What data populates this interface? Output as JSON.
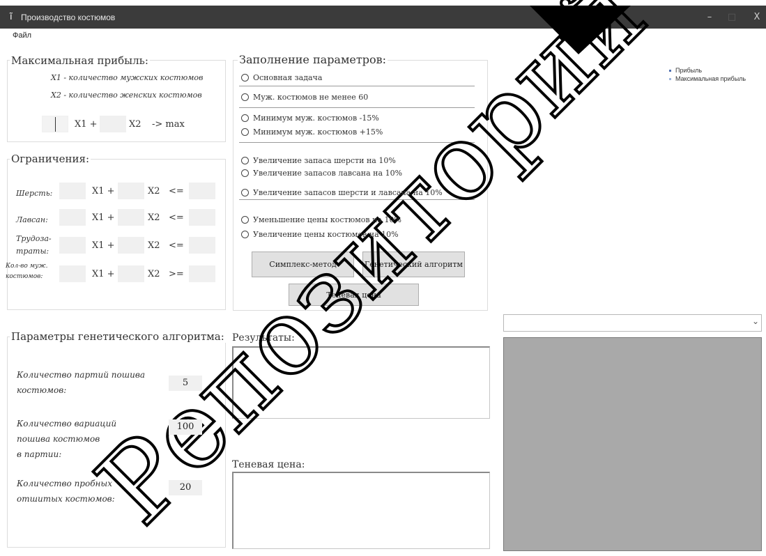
{
  "window": {
    "title": "Производство костюмов",
    "minimize_glyph": "–",
    "maximize_glyph": "□",
    "close_glyph": "X"
  },
  "menu": {
    "file": "Файл"
  },
  "max_profit": {
    "title": "Максимальная прибыль:",
    "x1_desc": "X1 - количество мужских костюмов",
    "x2_desc": "X2 - количество женских костюмов",
    "x1_label": "X1 +",
    "x2_label": "X2",
    "goal": "-> max",
    "x1_value": "",
    "x2_value": ""
  },
  "constraints": {
    "title": "Ограничения:",
    "rows": [
      {
        "label_lines": [
          "Шерсть:"
        ],
        "x1": "X1 +",
        "x2": "X2",
        "op": "<="
      },
      {
        "label_lines": [
          "Лавсан:"
        ],
        "x1": "X1 +",
        "x2": "X2",
        "op": "<="
      },
      {
        "label_lines": [
          "Трудоза-",
          "траты:"
        ],
        "x1": "X1 +",
        "x2": "X2",
        "op": "<="
      },
      {
        "label_lines": [
          "Кол-во муж.",
          "костюмов:"
        ],
        "x1": "X1 +",
        "x2": "X2",
        "op": ">="
      }
    ]
  },
  "params": {
    "title": "Заполнение параметров:",
    "options": [
      "Основная задача",
      "Муж. костюмов не менее 60",
      "Минимум муж. костюмов -15%",
      "Минимум муж. костюмов +15%",
      "Увеличение запаса шерсти на 10%",
      "Увеличение запасов лавсана на 10%",
      "Увеличение запасов шерсти и лавсана на 10%",
      "Уменьшение цены костюмов на 10%",
      "Увеличение цены костюмов на 10%"
    ],
    "buttons": {
      "simplex": "Симплекс-метод",
      "genetic": "Генетический алгоритм",
      "shadow": "Теневая цена"
    }
  },
  "genetic": {
    "title": "Параметры генетического алгоритма:",
    "fields": [
      {
        "label_lines": [
          "Количество партий пошива",
          "костюмов:"
        ],
        "value": "5"
      },
      {
        "label_lines": [
          "Количество вариаций",
          "пошива костюмов",
          "в партии:"
        ],
        "value": "100"
      },
      {
        "label_lines": [
          "Количество пробных",
          "отшитых костюмов:"
        ],
        "value": "20"
      }
    ]
  },
  "results": {
    "title": "Результаты:",
    "value": ""
  },
  "shadow_price": {
    "title": "Теневая цена:",
    "value": ""
  },
  "chart": {
    "legend": [
      {
        "name": "Прибыль",
        "color": "#4f6fb0"
      },
      {
        "name": "Максимальная прибыль",
        "color": "#9db4dc"
      }
    ]
  },
  "dropdown": {
    "selected": "",
    "arrow": "⌄"
  },
  "watermark": {
    "text": "Репозиторий",
    "color": "#000000"
  }
}
